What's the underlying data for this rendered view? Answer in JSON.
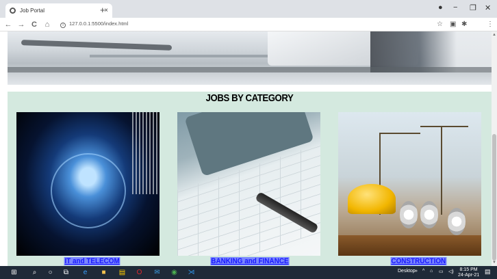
{
  "browser": {
    "tab_title": "Job Portal",
    "tab_close": "×",
    "new_tab": "+",
    "url": "127.0.0.1:5500/index.html",
    "nav": {
      "back": "←",
      "forward": "→",
      "reload": "C",
      "home": "⌂"
    },
    "window": {
      "minimize": "−",
      "maximize": "❐",
      "close": "✕"
    },
    "toolbar_icons": {
      "star": "☆",
      "extensions": "✱",
      "menu": "⋮"
    }
  },
  "page": {
    "heading": "JOBS BY CATEGORY",
    "categories": [
      {
        "label": "IT and TELECOM",
        "image": "it-telecom-image"
      },
      {
        "label": "BANKING and FINANCE",
        "image": "banking-finance-image"
      },
      {
        "label": "CONSTRUCTION",
        "image": "construction-image"
      }
    ]
  },
  "taskbar": {
    "desktop_label": "Desktop",
    "time": "8:15 PM",
    "date": "24-Apr-21",
    "chevron": "»"
  },
  "colors": {
    "content_bg": "#d4e9df",
    "link_color": "#1a1aff",
    "link_highlight": "#7a86ff",
    "taskbar_bg": "#1f2a38"
  }
}
